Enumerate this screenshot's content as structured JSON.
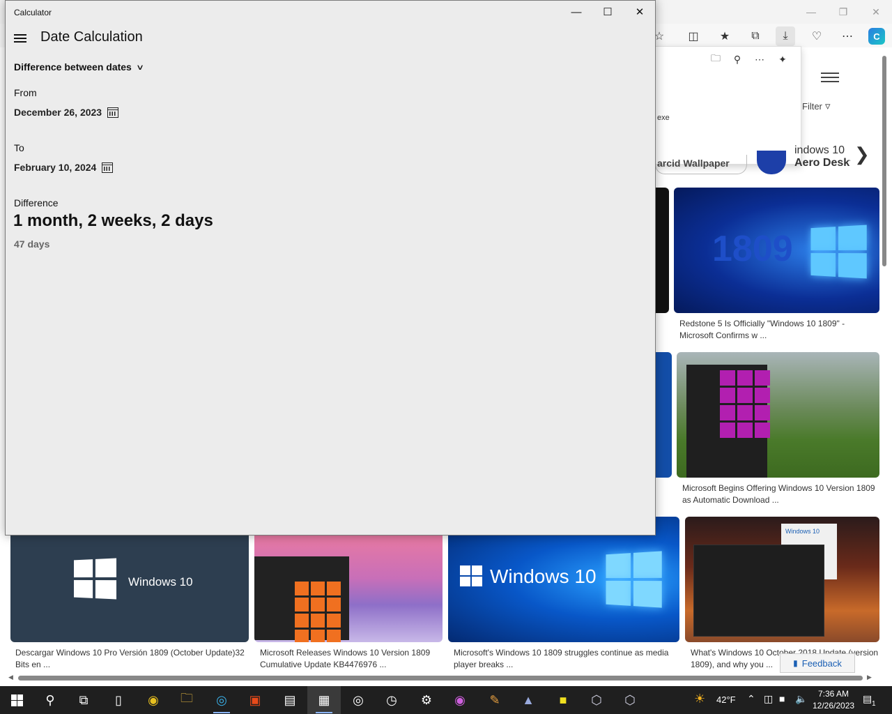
{
  "calculator": {
    "window_title": "Calculator",
    "mode_title": "Date Calculation",
    "calc_mode": "Difference between dates",
    "from_label": "From",
    "from_date": "December 26, 2023",
    "to_label": "To",
    "to_date": "February 10, 2024",
    "difference_label": "Difference",
    "difference_value": "1 month, 2 weeks, 2 days",
    "difference_days": "47 days"
  },
  "browser": {
    "downloads_file_suffix": "exe",
    "filter_label": "Filter",
    "chip_line1": "indows 10",
    "chip_line2": "Aero Deskto",
    "chip_pill_text": "arcid Wallpaper",
    "results": [
      {
        "caption": "Redstone 5 Is Officially \"Windows 10 1809\" - Microsoft Confirms w ...",
        "badge": "1809"
      },
      {
        "caption": "Microsoft Begins Offering Windows 10 Version 1809 as Automatic Download ..."
      },
      {
        "caption": "Descargar Windows 10 Pro Versión 1809 (October Update)32 Bits en ...",
        "badge": "Windows 10"
      },
      {
        "caption": "Microsoft Releases Windows 10 Version 1809 Cumulative Update KB4476976 ..."
      },
      {
        "caption": "Microsoft's Windows 10 1809 struggles continue as media player breaks ...",
        "badge": "Windows 10"
      },
      {
        "caption": "What's Windows 10 October 2018 Update (version 1809), and why you ...",
        "badge": "Windows 10"
      }
    ],
    "feedback_label": "Feedback"
  },
  "taskbar": {
    "temperature": "42°F",
    "time": "7:36 AM",
    "date": "12/26/2023",
    "notification_count": "1"
  },
  "colors": {
    "calc_background": "#ececec",
    "taskbar": "#1f1f1f",
    "accent": "#1a5fb4"
  }
}
